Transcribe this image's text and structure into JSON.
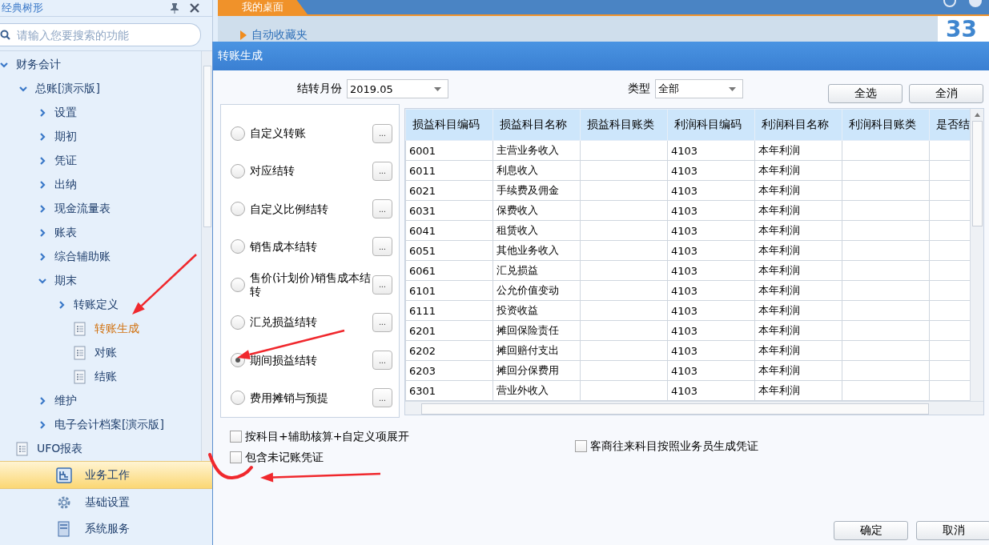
{
  "sidebar": {
    "title": "经典树形",
    "search": {
      "placeholder": "请输入您要搜索的功能"
    },
    "tree": [
      {
        "label": "财务会计",
        "kind": "folder",
        "expanded": true,
        "selected": false,
        "children": [
          {
            "label": "总账[演示版]",
            "kind": "folder",
            "expanded": true,
            "selected": false,
            "children": [
              {
                "label": "设置",
                "kind": "folder",
                "expanded": false,
                "selected": false
              },
              {
                "label": "期初",
                "kind": "folder",
                "expanded": false,
                "selected": false
              },
              {
                "label": "凭证",
                "kind": "folder",
                "expanded": false,
                "selected": false
              },
              {
                "label": "出纳",
                "kind": "folder",
                "expanded": false,
                "selected": false
              },
              {
                "label": "现金流量表",
                "kind": "folder",
                "expanded": false,
                "selected": false
              },
              {
                "label": "账表",
                "kind": "folder",
                "expanded": false,
                "selected": false
              },
              {
                "label": "综合辅助账",
                "kind": "folder",
                "expanded": false,
                "selected": false
              },
              {
                "label": "期末",
                "kind": "folder",
                "expanded": true,
                "selected": false,
                "children": [
                  {
                    "label": "转账定义",
                    "kind": "folder",
                    "expanded": false,
                    "selected": false
                  },
                  {
                    "label": "转账生成",
                    "kind": "leaf",
                    "selected": true
                  },
                  {
                    "label": "对账",
                    "kind": "leaf",
                    "selected": false
                  },
                  {
                    "label": "结账",
                    "kind": "leaf",
                    "selected": false
                  }
                ]
              },
              {
                "label": "维护",
                "kind": "folder",
                "expanded": false,
                "selected": false
              },
              {
                "label": "电子会计档案[演示版]",
                "kind": "folder",
                "expanded": false,
                "selected": false
              }
            ]
          }
        ]
      },
      {
        "label": "UFO报表",
        "kind": "leaf",
        "selected": false
      }
    ],
    "nav": [
      {
        "label": "业务工作",
        "kind": "work",
        "selected": true
      },
      {
        "label": "基础设置",
        "kind": "gear",
        "selected": false
      },
      {
        "label": "系统服务",
        "kind": "server",
        "selected": false
      }
    ]
  },
  "desktop": {
    "tab": {
      "label": "我的桌面",
      "selected": true
    },
    "favorites": "自动收藏夹",
    "big_number": "33"
  },
  "dialog": {
    "title": "转账生成",
    "month": {
      "label": "结转月份",
      "value": "2019.05"
    },
    "type": {
      "label": "类型",
      "value": "全部"
    },
    "buttons_top": [
      "全选",
      "全消"
    ],
    "options": [
      {
        "label": "自定义转账",
        "selected": false
      },
      {
        "label": "对应结转",
        "selected": false
      },
      {
        "label": "自定义比例结转",
        "selected": false
      },
      {
        "label": "销售成本结转",
        "selected": false
      },
      {
        "label": "售价(计划价)销售成本结转",
        "selected": false
      },
      {
        "label": "汇兑损益结转",
        "selected": false
      },
      {
        "label": "期间损益结转",
        "selected": true
      },
      {
        "label": "费用摊销与预提",
        "selected": false
      }
    ],
    "option_button": "...",
    "table": {
      "columns": [
        "损益科目编码",
        "损益科目名称",
        "损益科目账类",
        "利润科目编码",
        "利润科目名称",
        "利润科目账类",
        "是否结"
      ],
      "rows": [
        {
          "loss_code": "6001",
          "loss_name": "主营业务收入",
          "profit_code": "4103",
          "profit_name": "本年利润"
        },
        {
          "loss_code": "6011",
          "loss_name": "利息收入",
          "profit_code": "4103",
          "profit_name": "本年利润"
        },
        {
          "loss_code": "6021",
          "loss_name": "手续费及佣金",
          "profit_code": "4103",
          "profit_name": "本年利润"
        },
        {
          "loss_code": "6031",
          "loss_name": "保费收入",
          "profit_code": "4103",
          "profit_name": "本年利润"
        },
        {
          "loss_code": "6041",
          "loss_name": "租赁收入",
          "profit_code": "4103",
          "profit_name": "本年利润"
        },
        {
          "loss_code": "6051",
          "loss_name": "其他业务收入",
          "profit_code": "4103",
          "profit_name": "本年利润"
        },
        {
          "loss_code": "6061",
          "loss_name": "汇兑损益",
          "profit_code": "4103",
          "profit_name": "本年利润"
        },
        {
          "loss_code": "6101",
          "loss_name": "公允价值变动",
          "profit_code": "4103",
          "profit_name": "本年利润"
        },
        {
          "loss_code": "6111",
          "loss_name": "投资收益",
          "profit_code": "4103",
          "profit_name": "本年利润"
        },
        {
          "loss_code": "6201",
          "loss_name": "摊回保险责任",
          "profit_code": "4103",
          "profit_name": "本年利润"
        },
        {
          "loss_code": "6202",
          "loss_name": "摊回赔付支出",
          "profit_code": "4103",
          "profit_name": "本年利润"
        },
        {
          "loss_code": "6203",
          "loss_name": "摊回分保费用",
          "profit_code": "4103",
          "profit_name": "本年利润"
        },
        {
          "loss_code": "6301",
          "loss_name": "营业外收入",
          "profit_code": "4103",
          "profit_name": "本年利润"
        }
      ]
    },
    "checks_left": [
      {
        "label": "按科目+辅助核算+自定义项展开",
        "checked": false
      },
      {
        "label": "包含未记账凭证",
        "checked": false
      }
    ],
    "checks_right": [
      {
        "label": "客商往来科目按照业务员生成凭证",
        "checked": false
      }
    ],
    "buttons_bottom": [
      "确定",
      "取消"
    ]
  },
  "annotations": [
    {
      "kind": "arrow"
    },
    {
      "kind": "arrow"
    },
    {
      "kind": "arrow"
    },
    {
      "kind": "scribble"
    }
  ]
}
